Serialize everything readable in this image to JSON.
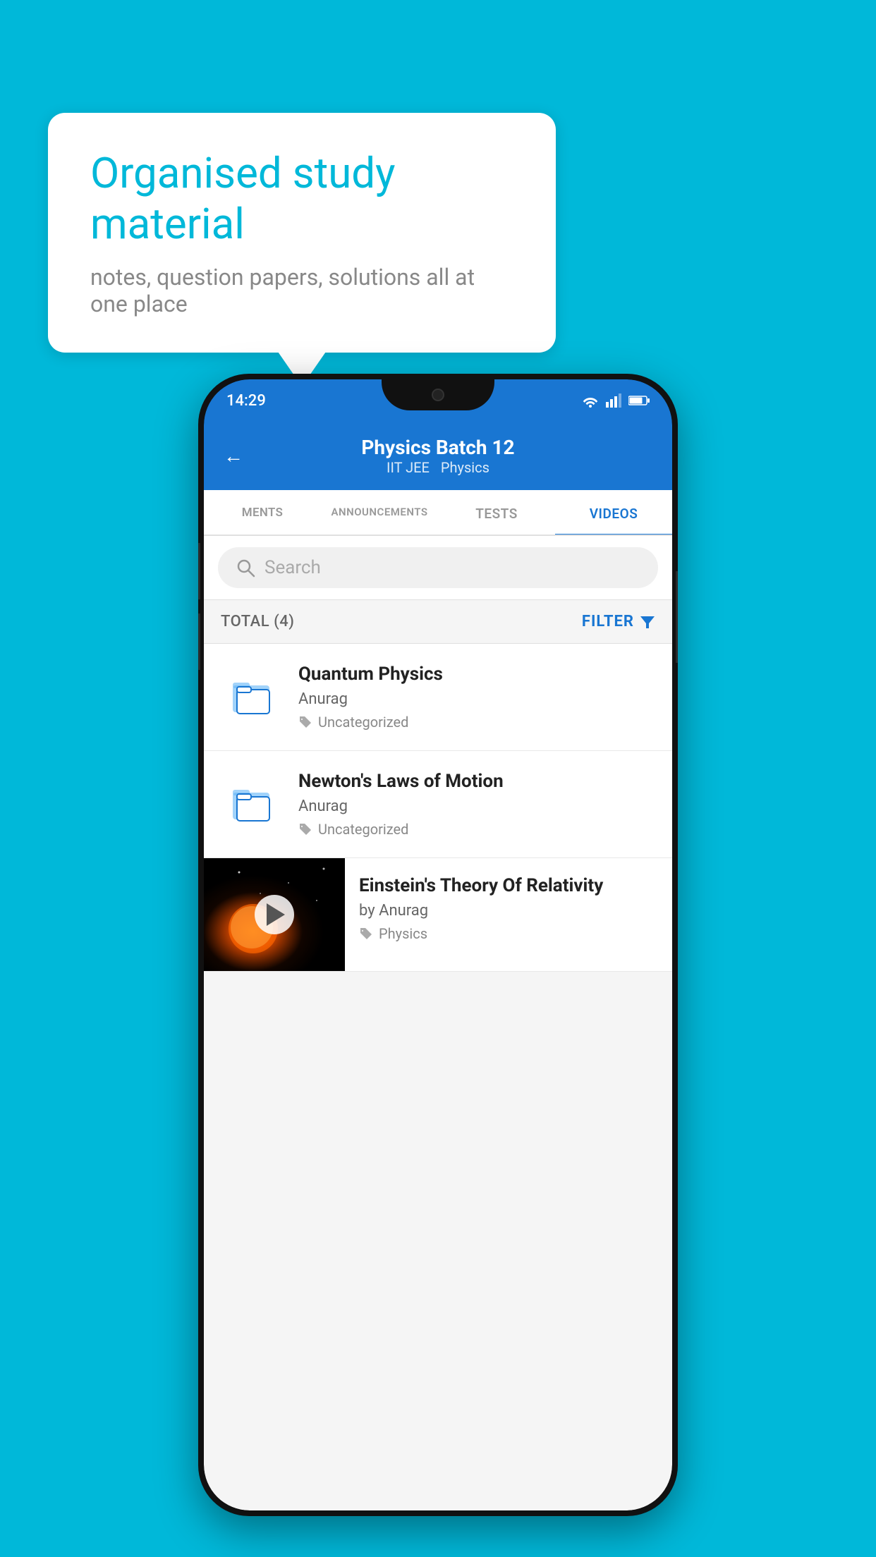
{
  "background_color": "#00b8d9",
  "speech_bubble": {
    "title": "Organised study material",
    "subtitle": "notes, question papers, solutions all at one place"
  },
  "status_bar": {
    "time": "14:29"
  },
  "app_header": {
    "title": "Physics Batch 12",
    "subtitle_left": "IIT JEE",
    "subtitle_right": "Physics"
  },
  "tabs": [
    {
      "label": "MENTS",
      "active": false
    },
    {
      "label": "ANNOUNCEMENTS",
      "active": false
    },
    {
      "label": "TESTS",
      "active": false
    },
    {
      "label": "VIDEOS",
      "active": true
    }
  ],
  "search": {
    "placeholder": "Search"
  },
  "filter_bar": {
    "total_label": "TOTAL (4)",
    "filter_label": "FILTER"
  },
  "videos": [
    {
      "id": 1,
      "title": "Quantum Physics",
      "author": "Anurag",
      "tag": "Uncategorized",
      "type": "folder"
    },
    {
      "id": 2,
      "title": "Newton's Laws of Motion",
      "author": "Anurag",
      "tag": "Uncategorized",
      "type": "folder"
    },
    {
      "id": 3,
      "title": "Einstein's Theory Of Relativity",
      "author": "by Anurag",
      "tag": "Physics",
      "type": "video"
    }
  ]
}
